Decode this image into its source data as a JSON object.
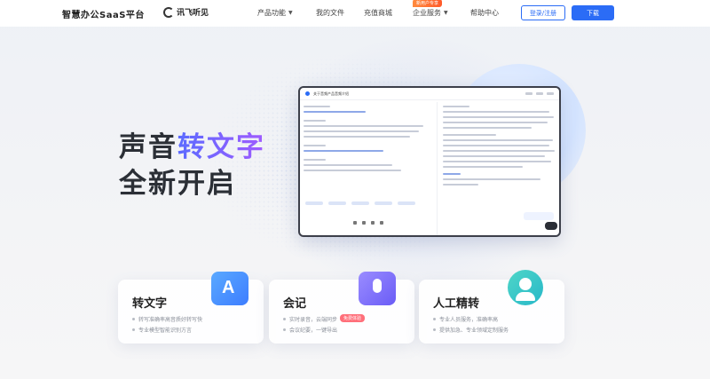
{
  "header": {
    "brand": "智慧办公SaaS平台",
    "logo_text": "讯飞听见",
    "nav": [
      {
        "label": "产品功能",
        "has_caret": true
      },
      {
        "label": "我的文件",
        "has_caret": false
      },
      {
        "label": "充值商城",
        "has_caret": false
      },
      {
        "label": "企业服务",
        "has_caret": true
      },
      {
        "label": "帮助中心",
        "has_caret": false
      }
    ],
    "badge": "新用户专享",
    "login_label": "登录/注册",
    "download_label": "下载"
  },
  "hero": {
    "title_prefix": "声音",
    "title_accent": "转文字",
    "title_line2": "全新开启"
  },
  "mock": {
    "title": "关于音频产品音频介绍"
  },
  "cards": [
    {
      "title": "转文字",
      "lines": [
        "转写准确率高音质好转写快",
        "专业模型智能识别方言"
      ]
    },
    {
      "title": "会记",
      "lines": [
        "实时录音，云端同步",
        "会议纪要，一键导出"
      ],
      "tag": "免费体验"
    },
    {
      "title": "人工精转",
      "lines": [
        "专业人员服务，准确率高",
        "提供加急、专业领域定制服务"
      ]
    }
  ],
  "colors": {
    "primary": "#2b6cf6",
    "accent_gradient": [
      "#5b6bff",
      "#a05bff"
    ],
    "tag": "#ff6f7a"
  }
}
